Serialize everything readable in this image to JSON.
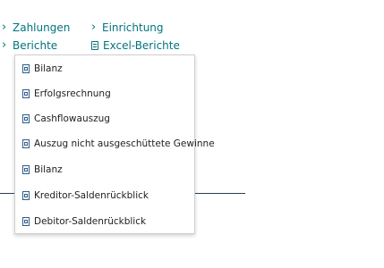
{
  "nav": {
    "zahlungen": {
      "label": "Zahlungen",
      "icon": "chevron-right-icon"
    },
    "einrichtung": {
      "label": "Einrichtung",
      "icon": "chevron-right-icon"
    },
    "berichte": {
      "label": "Berichte",
      "icon": "chevron-right-icon"
    },
    "excel_berichte": {
      "label": "Excel-Berichte",
      "icon": "document-icon"
    }
  },
  "menu": {
    "item_icon": "excel-report-icon",
    "items": [
      {
        "label": "Bilanz"
      },
      {
        "label": "Erfolgsrechnung"
      },
      {
        "label": "Cashflowauszug"
      },
      {
        "label": "Auszug nicht ausgeschüttete Gewinne"
      },
      {
        "label": "Bilanz"
      },
      {
        "label": "Kreditor-Saldenrückblick"
      },
      {
        "label": "Debitor-Saldenrückblick"
      }
    ]
  },
  "colors": {
    "link": "#00747d",
    "text": "#212121",
    "divider": "#2f3e4f",
    "icon": "#2f5d8a"
  }
}
